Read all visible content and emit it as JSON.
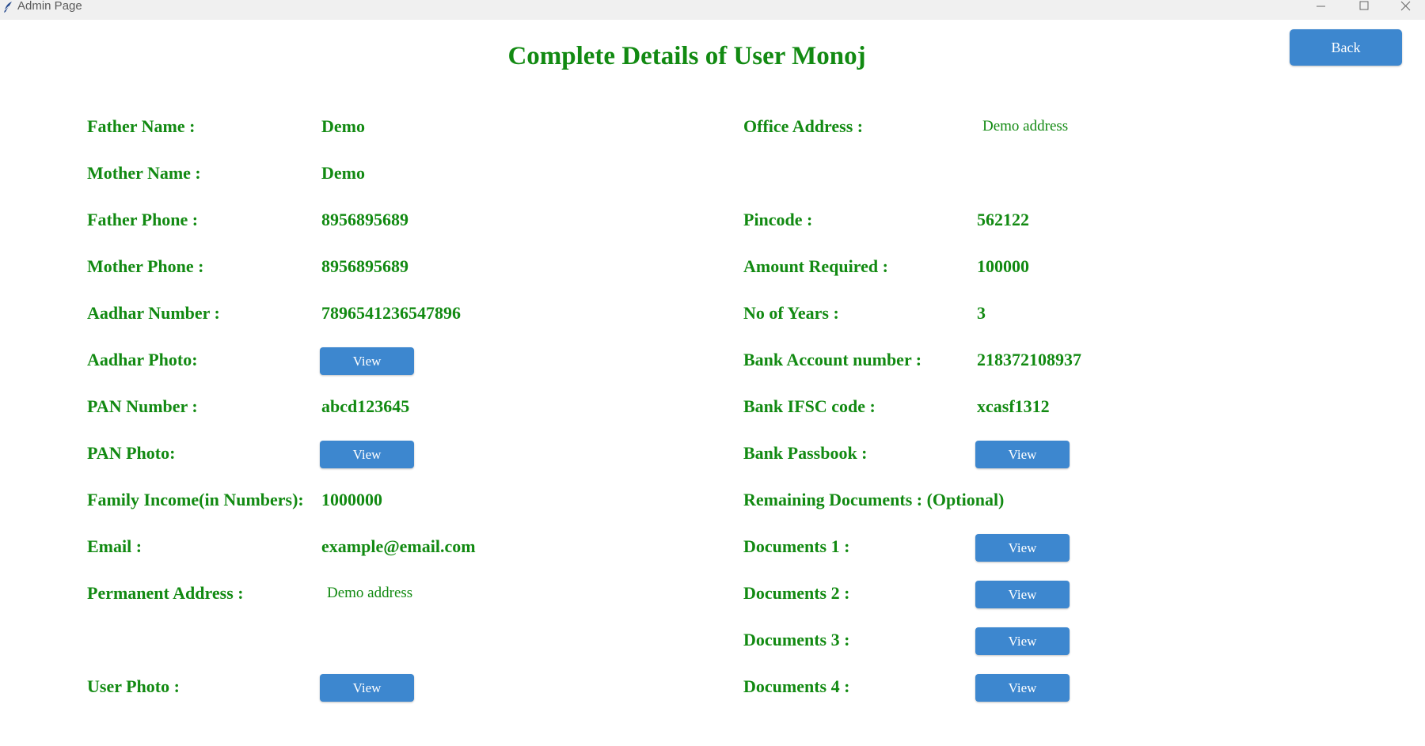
{
  "window": {
    "title": "Admin Page",
    "controls": [
      "minimize-icon",
      "maximize-icon",
      "close-icon"
    ]
  },
  "header": {
    "title": "Complete Details of User Monoj",
    "back_label": "Back"
  },
  "left": {
    "father_name": {
      "label": "Father Name :",
      "value": "Demo"
    },
    "mother_name": {
      "label": "Mother Name :",
      "value": "Demo"
    },
    "father_phone": {
      "label": "Father Phone :",
      "value": "8956895689"
    },
    "mother_phone": {
      "label": "Mother Phone :",
      "value": "8956895689"
    },
    "aadhar_number": {
      "label": "Aadhar Number :",
      "value": "7896541236547896"
    },
    "aadhar_photo": {
      "label": "Aadhar Photo:",
      "button": "View"
    },
    "pan_number": {
      "label": "PAN Number :",
      "value": "abcd123645"
    },
    "pan_photo": {
      "label": "PAN Photo:",
      "button": "View"
    },
    "family_income": {
      "label": "Family Income(in Numbers):",
      "value": "1000000"
    },
    "email": {
      "label": "Email :",
      "value": "example@email.com"
    },
    "permanent_address": {
      "label": "Permanent Address :",
      "value": "Demo address"
    },
    "user_photo": {
      "label": "User Photo :",
      "button": "View"
    }
  },
  "right": {
    "office_address": {
      "label": "Office Address :",
      "value": "Demo address"
    },
    "pincode": {
      "label": "Pincode :",
      "value": "562122"
    },
    "amount_required": {
      "label": "Amount Required :",
      "value": "100000"
    },
    "no_of_years": {
      "label": "No of Years :",
      "value": "3"
    },
    "bank_account": {
      "label": "Bank Account number :",
      "value": "218372108937"
    },
    "bank_ifsc": {
      "label": "Bank IFSC code :",
      "value": "xcasf1312"
    },
    "bank_passbook": {
      "label": "Bank Passbook :",
      "button": "View"
    },
    "remaining_documents": {
      "label": "Remaining Documents : (Optional)"
    },
    "documents_1": {
      "label": "Documents 1 :",
      "button": "View"
    },
    "documents_2": {
      "label": "Documents 2 :",
      "button": "View"
    },
    "documents_3": {
      "label": "Documents 3 :",
      "button": "View"
    },
    "documents_4": {
      "label": "Documents 4 :",
      "button": "View"
    }
  },
  "colors": {
    "text": "#128a12",
    "button": "#3d87cf",
    "button_text": "#ffffff",
    "titlebar": "#f0f0f0"
  }
}
